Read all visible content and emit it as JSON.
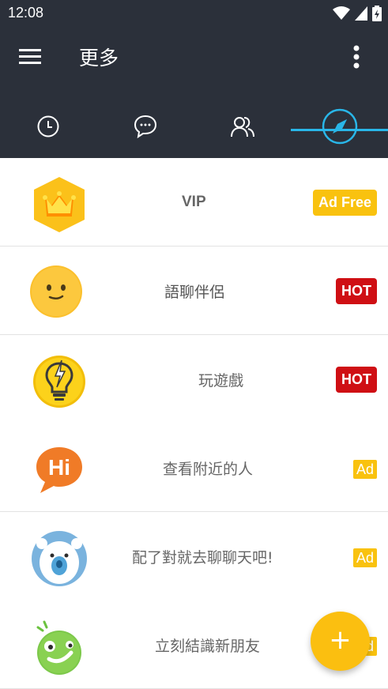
{
  "status_bar": {
    "time": "12:08"
  },
  "app_bar": {
    "title": "更多",
    "menu_icon": "hamburger-menu-icon",
    "overflow_icon": "more-vertical-icon"
  },
  "tabs": [
    {
      "icon": "clock-icon",
      "selected": false
    },
    {
      "icon": "chat-bubble-icon",
      "selected": false
    },
    {
      "icon": "people-icon",
      "selected": false
    },
    {
      "icon": "compass-icon",
      "selected": true
    }
  ],
  "items": [
    {
      "label": "VIP",
      "icon": "crown-icon",
      "badge": "Ad Free"
    },
    {
      "label": "語聊伴侶",
      "icon": "smiley-face-icon",
      "badge": "HOT"
    },
    {
      "label": "玩遊戲",
      "icon": "lightbulb-icon",
      "badge": "HOT"
    },
    {
      "label": "查看附近的人",
      "icon": "hi-bubble-icon",
      "badge": "Ad"
    },
    {
      "label": "配了對就去聊聊天吧!",
      "icon": "polar-bear-icon",
      "badge": "Ad"
    },
    {
      "label": "立刻結識新朋友",
      "icon": "green-face-icon",
      "badge": "Ad"
    }
  ],
  "fab": {
    "label": "+",
    "icon": "plus-icon"
  },
  "colors": {
    "app_bar": "#2b303a",
    "tab_indicator": "#29b6e8",
    "badge_yellow": "#f9c20f",
    "badge_red": "#cf0f14",
    "fab": "#fbbf10"
  }
}
